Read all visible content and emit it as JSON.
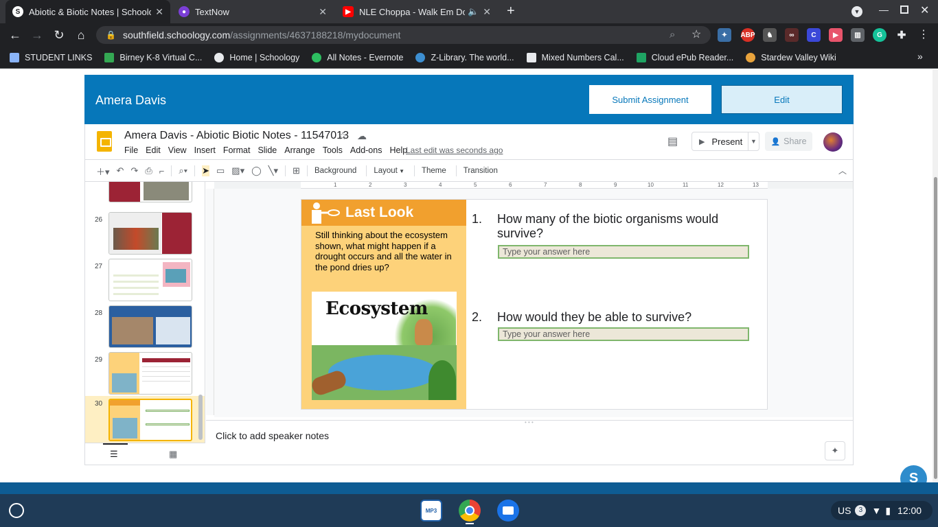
{
  "browser": {
    "tabs": [
      {
        "title": "Abiotic & Biotic Notes | Schoology",
        "icon": "schoology-icon"
      },
      {
        "title": "TextNow",
        "icon": "textnow-icon"
      },
      {
        "title": "NLE Choppa - Walk Em Down",
        "icon": "youtube-icon"
      }
    ],
    "url_host": "southfield.schoology.com",
    "url_path": "/assignments/4637188218/mydocument",
    "bookmarks": [
      {
        "label": "STUDENT LINKS",
        "color": "#8ab4f8"
      },
      {
        "label": "Birney K-8 Virtual C...",
        "color": "#34a853"
      },
      {
        "label": "Home | Schoology",
        "color": "#e8eaed"
      },
      {
        "label": "All Notes - Evernote",
        "color": "#2dbe60"
      },
      {
        "label": "Z-Library. The world...",
        "color": "#3d8fd1"
      },
      {
        "label": "Mixed Numbers Cal...",
        "color": "#e8eaed"
      },
      {
        "label": "Cloud ePub Reader...",
        "color": "#1fa463"
      },
      {
        "label": "Stardew Valley Wiki",
        "color": "#e8a33c"
      }
    ]
  },
  "schoology": {
    "student_name": "Amera Davis",
    "submit_label": "Submit Assignment",
    "edit_label": "Edit"
  },
  "slides_app": {
    "doc_title": "Amera Davis - Abiotic  Biotic Notes - 11547013",
    "menu": [
      "File",
      "Edit",
      "View",
      "Insert",
      "Format",
      "Slide",
      "Arrange",
      "Tools",
      "Add-ons",
      "Help"
    ],
    "last_edit": "Last edit was seconds ago",
    "present_label": "Present",
    "share_label": "Share",
    "toolbar_words": [
      "Background",
      "Layout",
      "Theme",
      "Transition"
    ],
    "ruler_numbers": [
      "1",
      "2",
      "3",
      "4",
      "5",
      "6",
      "7",
      "8",
      "9",
      "10",
      "11",
      "12",
      "13"
    ],
    "slide_numbers": [
      "26",
      "27",
      "28",
      "29",
      "30"
    ],
    "speaker_notes_placeholder": "Click to add speaker notes"
  },
  "slide": {
    "heading": "Last Look",
    "prompt": "Still thinking about the ecosystem shown, what might happen if a drought occurs and all the water in the pond dries up?",
    "image_title": "Ecosystem",
    "questions": [
      {
        "num": "1.",
        "text": "How many of the biotic organisms would survive?",
        "answer_placeholder": "Type your answer here"
      },
      {
        "num": "2.",
        "text": "How would they be able to survive?",
        "answer_placeholder": "Type your answer here"
      }
    ]
  },
  "shelf": {
    "locale": "US",
    "notifications": "3",
    "time": "12:00",
    "chat_initial": "S"
  }
}
